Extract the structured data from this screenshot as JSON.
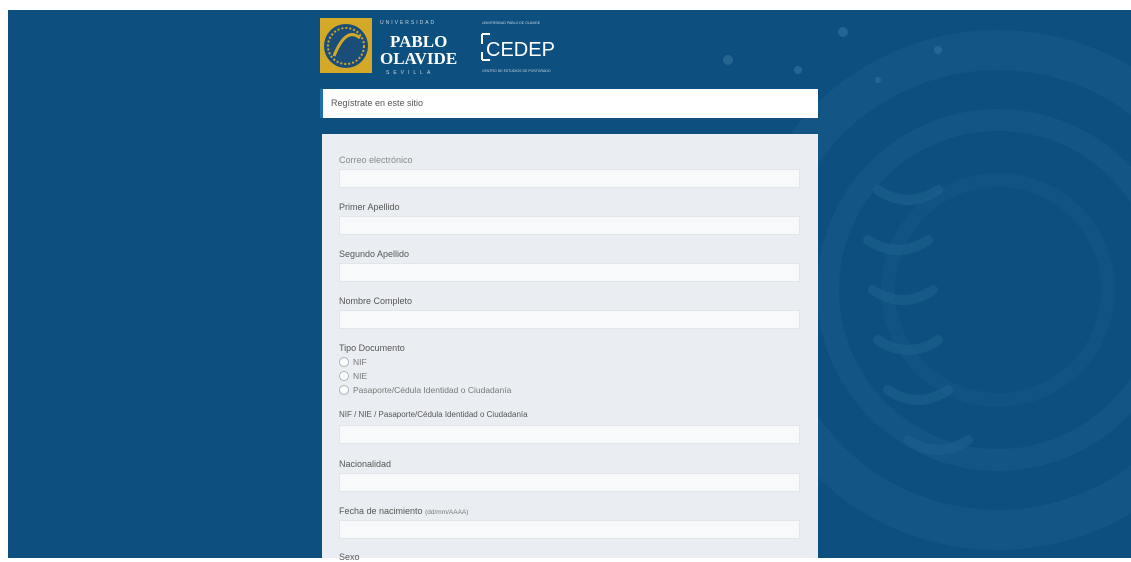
{
  "header": {
    "university_top": "UNIVERSIDAD",
    "university_name_line1": "PABLO",
    "university_name_line2": "OLAVIDE",
    "university_city": "SEVILLA",
    "cedep_top": "UNIVERSIDAD PABLO DE OLAVIDE",
    "cedep_name": "CEDEP",
    "cedep_sub": "CENTRO DE ESTUDIOS DE POSTGRADO"
  },
  "register_bar": {
    "label": "Regístrate en este sitio"
  },
  "form": {
    "email_label": "Correo electrónico",
    "first_surname_label": "Primer Apellido",
    "second_surname_label": "Segundo Apellido",
    "full_name_label": "Nombre Completo",
    "doc_type_label": "Tipo Documento",
    "doc_options": [
      "NIF",
      "NIE",
      "Pasaporte/Cédula Identidad o Ciudadanía"
    ],
    "doc_number_label": "NIF / NIE / Pasaporte/Cédula Identidad o Ciudadanía",
    "nationality_label": "Nacionalidad",
    "birthdate_label": "Fecha de nacimiento",
    "birthdate_hint": "(dd/mm/AAAA)",
    "sex_label": "Sexo"
  },
  "colors": {
    "background": "#0d4f7e",
    "form_bg": "#eaeef2",
    "accent": "#1c6fa8"
  }
}
